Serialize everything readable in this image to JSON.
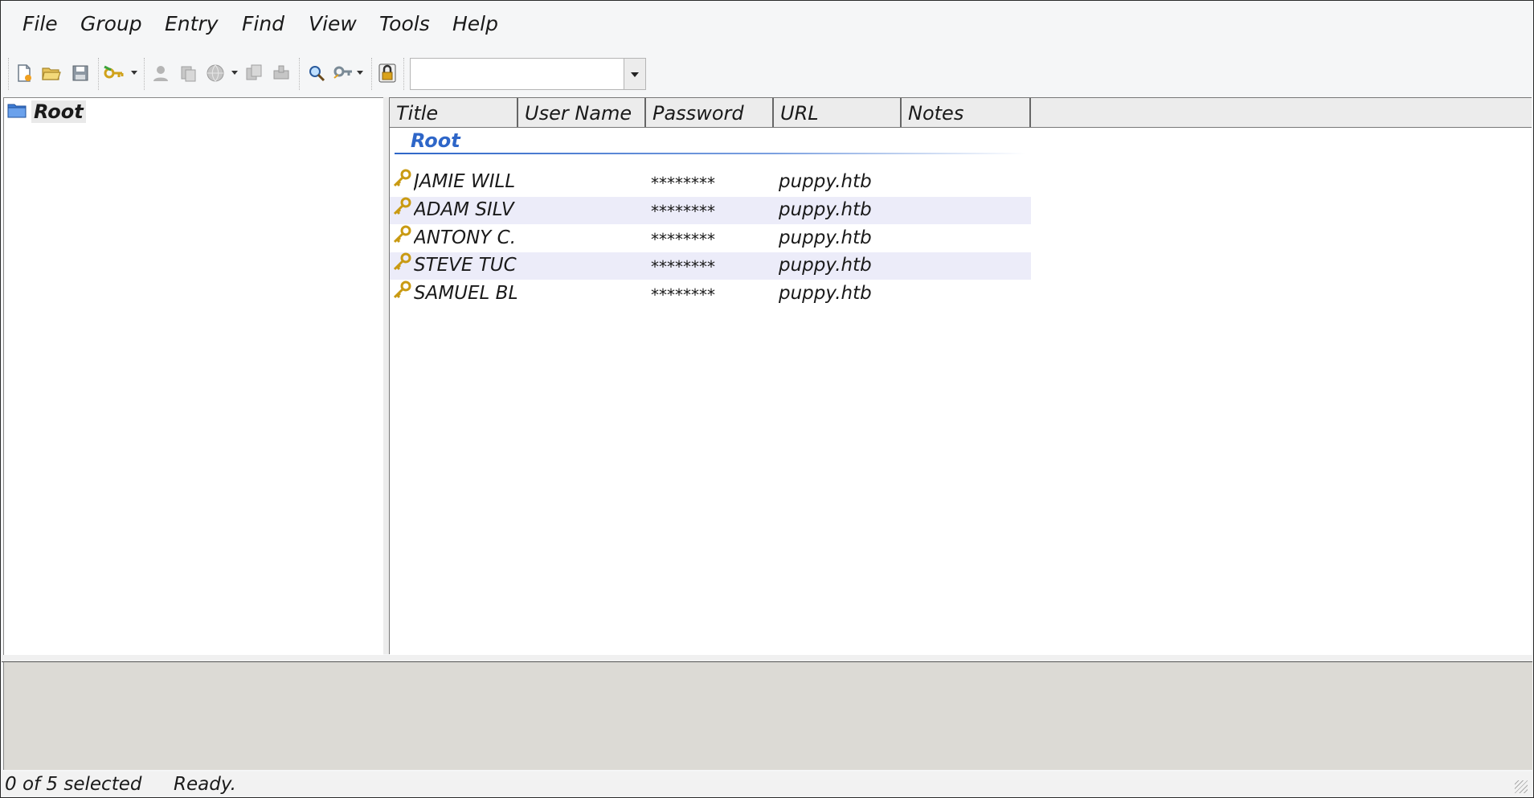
{
  "menu": {
    "items": [
      {
        "label": "File"
      },
      {
        "label": "Group"
      },
      {
        "label": "Entry"
      },
      {
        "label": "Find"
      },
      {
        "label": "View"
      },
      {
        "label": "Tools"
      },
      {
        "label": "Help"
      }
    ]
  },
  "toolbar": {
    "quick_search": {
      "value": "",
      "placeholder": ""
    },
    "icons": [
      "new-database-icon",
      "open-database-icon",
      "save-database-icon",
      "add-entry-icon",
      "copy-username-icon",
      "copy-password-icon",
      "open-url-icon",
      "copy-entry-icon",
      "perform-autotype-icon",
      "find-icon",
      "password-generator-icon",
      "lock-workspace-icon"
    ]
  },
  "tree": {
    "root_label": "Root"
  },
  "list": {
    "columns": [
      "Title",
      "User Name",
      "Password",
      "URL",
      "Notes"
    ],
    "group_label": "Root",
    "rows": [
      {
        "title": "JAMIE WILL",
        "user": "",
        "password": "********",
        "url": "puppy.htb",
        "notes": ""
      },
      {
        "title": "ADAM SILV",
        "user": "",
        "password": "********",
        "url": "puppy.htb",
        "notes": ""
      },
      {
        "title": "ANTONY C.",
        "user": "",
        "password": "********",
        "url": "puppy.htb",
        "notes": ""
      },
      {
        "title": "STEVE TUC",
        "user": "",
        "password": "********",
        "url": "puppy.htb",
        "notes": ""
      },
      {
        "title": "SAMUEL BL",
        "user": "",
        "password": "********",
        "url": "puppy.htb",
        "notes": ""
      }
    ]
  },
  "status": {
    "selection": "0 of 5 selected",
    "state": "Ready."
  },
  "colors": {
    "group_label": "#2e66c8",
    "alt_row": "#ececf9",
    "detail_bg": "#dcdad5"
  }
}
